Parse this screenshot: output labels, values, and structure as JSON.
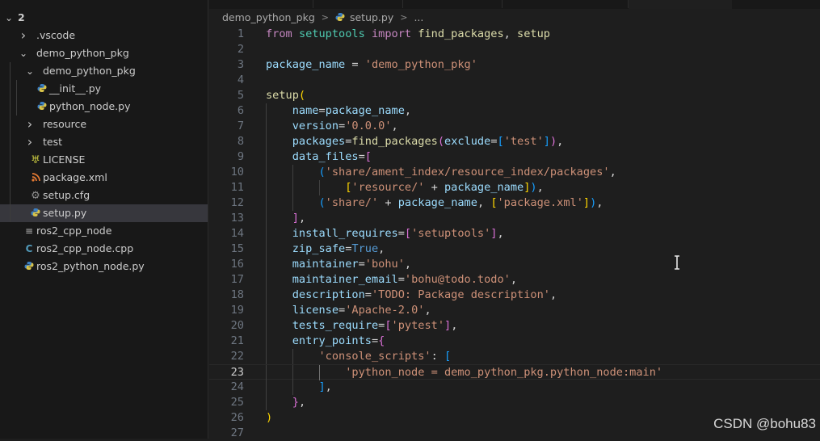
{
  "explorer": {
    "root_label": "2",
    "items": [
      {
        "label": ".vscode",
        "kind": "folder",
        "depth": 1,
        "open": false
      },
      {
        "label": "demo_python_pkg",
        "kind": "folder",
        "depth": 1,
        "open": true
      },
      {
        "label": "demo_python_pkg",
        "kind": "folder",
        "depth": 2,
        "open": true
      },
      {
        "label": "__init__.py",
        "kind": "python",
        "depth": 3
      },
      {
        "label": "python_node.py",
        "kind": "python",
        "depth": 3
      },
      {
        "label": "resource",
        "kind": "folder",
        "depth": 2,
        "open": false
      },
      {
        "label": "test",
        "kind": "folder",
        "depth": 2,
        "open": false
      },
      {
        "label": "LICENSE",
        "kind": "license",
        "depth": 2
      },
      {
        "label": "package.xml",
        "kind": "xml",
        "depth": 2
      },
      {
        "label": "setup.cfg",
        "kind": "config",
        "depth": 2
      },
      {
        "label": "setup.py",
        "kind": "python",
        "depth": 2,
        "selected": true
      },
      {
        "label": "ros2_cpp_node",
        "kind": "text",
        "depth": 1
      },
      {
        "label": "ros2_cpp_node.cpp",
        "kind": "cpp",
        "depth": 1
      },
      {
        "label": "ros2_python_node.py",
        "kind": "python",
        "depth": 1
      }
    ]
  },
  "breadcrumb": {
    "folder": "demo_python_pkg",
    "file": "setup.py",
    "tail": "..."
  },
  "editor": {
    "current_line": 23,
    "lines": [
      {
        "n": "1",
        "indent": 0,
        "tokens": [
          [
            "from",
            "kw"
          ],
          [
            " ",
            ""
          ],
          [
            "setuptools",
            "mod"
          ],
          [
            " ",
            ""
          ],
          [
            "import",
            "kw"
          ],
          [
            " ",
            ""
          ],
          [
            "find_packages",
            "fn"
          ],
          [
            ", ",
            ""
          ],
          [
            "setup",
            "fn"
          ]
        ]
      },
      {
        "n": "2",
        "indent": 0,
        "tokens": []
      },
      {
        "n": "3",
        "indent": 0,
        "tokens": [
          [
            "package_name",
            "var"
          ],
          [
            " = ",
            ""
          ],
          [
            "'demo_python_pkg'",
            "str"
          ]
        ]
      },
      {
        "n": "4",
        "indent": 0,
        "tokens": []
      },
      {
        "n": "5",
        "indent": 0,
        "tokens": [
          [
            "setup",
            "fn"
          ],
          [
            "(",
            "b1"
          ]
        ]
      },
      {
        "n": "6",
        "indent": 1,
        "tokens": [
          [
            "    ",
            ""
          ],
          [
            "name",
            "var"
          ],
          [
            "=",
            ""
          ],
          [
            "package_name",
            "var"
          ],
          [
            ",",
            ""
          ]
        ]
      },
      {
        "n": "7",
        "indent": 1,
        "tokens": [
          [
            "    ",
            ""
          ],
          [
            "version",
            "var"
          ],
          [
            "=",
            ""
          ],
          [
            "'0.0.0'",
            "str"
          ],
          [
            ",",
            ""
          ]
        ]
      },
      {
        "n": "8",
        "indent": 1,
        "tokens": [
          [
            "    ",
            ""
          ],
          [
            "packages",
            "var"
          ],
          [
            "=",
            ""
          ],
          [
            "find_packages",
            "fn"
          ],
          [
            "(",
            "b2"
          ],
          [
            "exclude",
            "var"
          ],
          [
            "=",
            ""
          ],
          [
            "[",
            "b3"
          ],
          [
            "'test'",
            "str"
          ],
          [
            "]",
            "b3"
          ],
          [
            ")",
            "b2"
          ],
          [
            ",",
            ""
          ]
        ]
      },
      {
        "n": "9",
        "indent": 1,
        "tokens": [
          [
            "    ",
            ""
          ],
          [
            "data_files",
            "var"
          ],
          [
            "=",
            ""
          ],
          [
            "[",
            "b2"
          ]
        ]
      },
      {
        "n": "10",
        "indent": 2,
        "tokens": [
          [
            "        ",
            ""
          ],
          [
            "(",
            "b3"
          ],
          [
            "'share/ament_index/resource_index/packages'",
            "str"
          ],
          [
            ",",
            ""
          ]
        ]
      },
      {
        "n": "11",
        "indent": 3,
        "tokens": [
          [
            "            ",
            ""
          ],
          [
            "[",
            "b1"
          ],
          [
            "'resource/'",
            "str"
          ],
          [
            " + ",
            ""
          ],
          [
            "package_name",
            "var"
          ],
          [
            "]",
            "b1"
          ],
          [
            ")",
            "b3"
          ],
          [
            ",",
            ""
          ]
        ]
      },
      {
        "n": "12",
        "indent": 2,
        "tokens": [
          [
            "        ",
            ""
          ],
          [
            "(",
            "b3"
          ],
          [
            "'share/'",
            "str"
          ],
          [
            " + ",
            ""
          ],
          [
            "package_name",
            "var"
          ],
          [
            ", ",
            ""
          ],
          [
            "[",
            "b1"
          ],
          [
            "'package.xml'",
            "str"
          ],
          [
            "]",
            "b1"
          ],
          [
            ")",
            "b3"
          ],
          [
            ",",
            ""
          ]
        ]
      },
      {
        "n": "13",
        "indent": 1,
        "tokens": [
          [
            "    ",
            ""
          ],
          [
            "]",
            "b2"
          ],
          [
            ",",
            ""
          ]
        ]
      },
      {
        "n": "14",
        "indent": 1,
        "tokens": [
          [
            "    ",
            ""
          ],
          [
            "install_requires",
            "var"
          ],
          [
            "=",
            ""
          ],
          [
            "[",
            "b2"
          ],
          [
            "'setuptools'",
            "str"
          ],
          [
            "]",
            "b2"
          ],
          [
            ",",
            ""
          ]
        ]
      },
      {
        "n": "15",
        "indent": 1,
        "tokens": [
          [
            "    ",
            ""
          ],
          [
            "zip_safe",
            "var"
          ],
          [
            "=",
            ""
          ],
          [
            "True",
            "kc"
          ],
          [
            ",",
            ""
          ]
        ]
      },
      {
        "n": "16",
        "indent": 1,
        "tokens": [
          [
            "    ",
            ""
          ],
          [
            "maintainer",
            "var"
          ],
          [
            "=",
            ""
          ],
          [
            "'bohu'",
            "str"
          ],
          [
            ",",
            ""
          ]
        ]
      },
      {
        "n": "17",
        "indent": 1,
        "tokens": [
          [
            "    ",
            ""
          ],
          [
            "maintainer_email",
            "var"
          ],
          [
            "=",
            ""
          ],
          [
            "'bohu@todo.todo'",
            "str"
          ],
          [
            ",",
            ""
          ]
        ]
      },
      {
        "n": "18",
        "indent": 1,
        "tokens": [
          [
            "    ",
            ""
          ],
          [
            "description",
            "var"
          ],
          [
            "=",
            ""
          ],
          [
            "'TODO: Package description'",
            "str"
          ],
          [
            ",",
            ""
          ]
        ]
      },
      {
        "n": "19",
        "indent": 1,
        "tokens": [
          [
            "    ",
            ""
          ],
          [
            "license",
            "var"
          ],
          [
            "=",
            ""
          ],
          [
            "'Apache-2.0'",
            "str"
          ],
          [
            ",",
            ""
          ]
        ]
      },
      {
        "n": "20",
        "indent": 1,
        "tokens": [
          [
            "    ",
            ""
          ],
          [
            "tests_require",
            "var"
          ],
          [
            "=",
            ""
          ],
          [
            "[",
            "b2"
          ],
          [
            "'pytest'",
            "str"
          ],
          [
            "]",
            "b2"
          ],
          [
            ",",
            ""
          ]
        ]
      },
      {
        "n": "21",
        "indent": 1,
        "tokens": [
          [
            "    ",
            ""
          ],
          [
            "entry_points",
            "var"
          ],
          [
            "=",
            ""
          ],
          [
            "{",
            "b2"
          ]
        ]
      },
      {
        "n": "22",
        "indent": 2,
        "tokens": [
          [
            "        ",
            ""
          ],
          [
            "'console_scripts'",
            "str"
          ],
          [
            ": ",
            ""
          ],
          [
            "[",
            "b3"
          ]
        ]
      },
      {
        "n": "23",
        "indent": 3,
        "tokens": [
          [
            "            ",
            ""
          ],
          [
            "'python_node = demo_python_pkg.python_node:main'",
            "str"
          ]
        ]
      },
      {
        "n": "24",
        "indent": 2,
        "tokens": [
          [
            "        ",
            ""
          ],
          [
            "]",
            "b3"
          ],
          [
            ",",
            ""
          ]
        ]
      },
      {
        "n": "25",
        "indent": 1,
        "tokens": [
          [
            "    ",
            ""
          ],
          [
            "}",
            "b2"
          ],
          [
            ",",
            ""
          ]
        ]
      },
      {
        "n": "26",
        "indent": 0,
        "tokens": [
          [
            ")",
            "b1"
          ]
        ]
      },
      {
        "n": "27",
        "indent": 0,
        "tokens": []
      }
    ]
  },
  "watermark": "CSDN @bohu83",
  "icons": {
    "folder_closed": "chevron-right-icon",
    "folder_open": "chevron-down-icon",
    "python": "python-file-icon",
    "license": "license-file-icon",
    "xml": "rss-xml-file-icon",
    "config": "gear-file-icon",
    "text": "text-lines-file-icon",
    "cpp": "cpp-file-icon"
  },
  "colors": {
    "editor_bg": "#1e1e1e",
    "sidebar_bg": "#181818",
    "selection_bg": "#37373d",
    "python_icon": "#3b7fc4",
    "xml_icon": "#e37933",
    "license_icon": "#cbcb41",
    "cpp_icon": "#519aba"
  }
}
